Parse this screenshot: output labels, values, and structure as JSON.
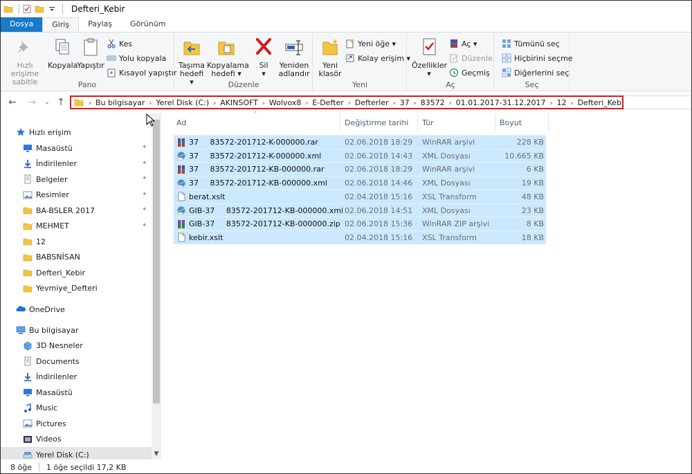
{
  "window": {
    "title": "Defteri_Kebir"
  },
  "tabs": [
    "Dosya",
    "Giriş",
    "Paylaş",
    "Görünüm"
  ],
  "ribbon": {
    "pano": {
      "label": "Pano",
      "pin_line1": "Hızlı erişime",
      "pin_line2": "sabitle",
      "copy": "Kopyala",
      "paste": "Yapıştır",
      "cut": "Kes",
      "copy_path": "Yolu kopyala",
      "paste_shortcut": "Kısayol yapıştır"
    },
    "duzenle": {
      "label": "Düzenle",
      "move_line1": "Taşıma",
      "move_line2": "hedefi ▾",
      "copyto_line1": "Kopyalama",
      "copyto_line2": "hedefi ▾",
      "delete_line1": "Sil",
      "delete_line2": "▾",
      "rename_line1": "Yeniden",
      "rename_line2": "adlandır"
    },
    "yeni": {
      "label": "Yeni",
      "folder_line1": "Yeni",
      "folder_line2": "klasör",
      "new_item": "Yeni öğe ▾",
      "easy_access": "Kolay erişim ▾"
    },
    "ac": {
      "label": "Aç",
      "props_line1": "Özellikler",
      "props_line2": "▾",
      "open": "Aç ▾",
      "edit": "Düzenle",
      "history": "Geçmiş"
    },
    "sec": {
      "label": "Seç",
      "select_all": "Tümünü seç",
      "select_none": "Hiçbirini seçme",
      "invert": "Diğerlerini seç"
    }
  },
  "address": {
    "crumbs": [
      "Bu bilgisayar",
      "Yerel Disk (C:)",
      "AKINSOFT",
      "Wolvox8",
      "E-Defter",
      "Defterler",
      "37",
      "83572",
      "01.01.2017-31.12.2017",
      "12",
      "Defteri_Kebir"
    ]
  },
  "nav": {
    "quick_access": "Hızlı erişim",
    "quick_items": [
      {
        "label": "Masaüstü",
        "icon": "desktop-icon",
        "pinned": true
      },
      {
        "label": "İndirilenler",
        "icon": "download-icon",
        "pinned": true
      },
      {
        "label": "Belgeler",
        "icon": "documents-icon",
        "pinned": true
      },
      {
        "label": "Resimler",
        "icon": "pictures-icon",
        "pinned": true
      },
      {
        "label": "BA-BSLER 2017",
        "icon": "folder-icon",
        "pinned": true
      },
      {
        "label": "MEHMET",
        "icon": "folder-icon",
        "pinned": true
      },
      {
        "label": "12",
        "icon": "folder-icon",
        "pinned": false
      },
      {
        "label": "BABSNİSAN",
        "icon": "folder-icon",
        "pinned": false
      },
      {
        "label": "Defteri_Kebir",
        "icon": "folder-icon",
        "pinned": false
      },
      {
        "label": "Yevmiye_Defteri",
        "icon": "folder-icon",
        "pinned": false
      }
    ],
    "onedrive": "OneDrive",
    "this_pc": "Bu bilgisayar",
    "pc_items": [
      {
        "label": "3D Nesneler",
        "icon": "3d-objects-icon"
      },
      {
        "label": "Documents",
        "icon": "documents-icon"
      },
      {
        "label": "İndirilenler",
        "icon": "download-icon"
      },
      {
        "label": "Masaüstü",
        "icon": "desktop-icon"
      },
      {
        "label": "Music",
        "icon": "music-icon"
      },
      {
        "label": "Pictures",
        "icon": "pictures-icon"
      },
      {
        "label": "Videos",
        "icon": "videos-icon"
      },
      {
        "label": "Yerel Disk (C:)",
        "icon": "disk-icon"
      }
    ]
  },
  "columns": {
    "name": "Ad",
    "date": "Değiştirme tarihi",
    "type": "Tür",
    "size": "Boyut"
  },
  "files": [
    {
      "name": "37   83572-201712-K-000000.rar",
      "date": "02.06.2018 18:29",
      "type": "WinRAR arşivi",
      "size": "228 KB",
      "icon": "rar-icon"
    },
    {
      "name": "37   83572-201712-K-000000.xml",
      "date": "02.06.2018 14:43",
      "type": "XML Dosyası",
      "size": "10.665 KB",
      "icon": "xml-icon"
    },
    {
      "name": "37   83572-201712-KB-000000.rar",
      "date": "02.06.2018 18:29",
      "type": "WinRAR arşivi",
      "size": "6 KB",
      "icon": "rar-icon"
    },
    {
      "name": "37   83572-201712-KB-000000.xml",
      "date": "02.06.2018 14:46",
      "type": "XML Dosyası",
      "size": "19 KB",
      "icon": "xml-icon"
    },
    {
      "name": "berat.xslt",
      "date": "02.04.2018 15:16",
      "type": "XSL Transform",
      "size": "48 KB",
      "icon": "xslt-icon"
    },
    {
      "name": "GIB-37   83572-201712-KB-000000.xml",
      "date": "02.06.2018 14:51",
      "type": "XML Dosyası",
      "size": "23 KB",
      "icon": "xml-icon"
    },
    {
      "name": "GIB-37   83572-201712-KB-000000.zip",
      "date": "02.06.2018 15:36",
      "type": "WinRAR ZIP arşivi",
      "size": "8 KB",
      "icon": "zip-icon"
    },
    {
      "name": "kebir.xslt",
      "date": "02.04.2018 15:16",
      "type": "XSL Transform",
      "size": "18 KB",
      "icon": "xslt-icon"
    }
  ],
  "status": {
    "count": "8 öğe",
    "selected": "1 öğe seçildi  17,2 KB"
  },
  "colors": {
    "file_tab": "#1979ca",
    "selection": "#cce8ff",
    "address_highlight": "#e01818",
    "folder": "#f4c542"
  }
}
